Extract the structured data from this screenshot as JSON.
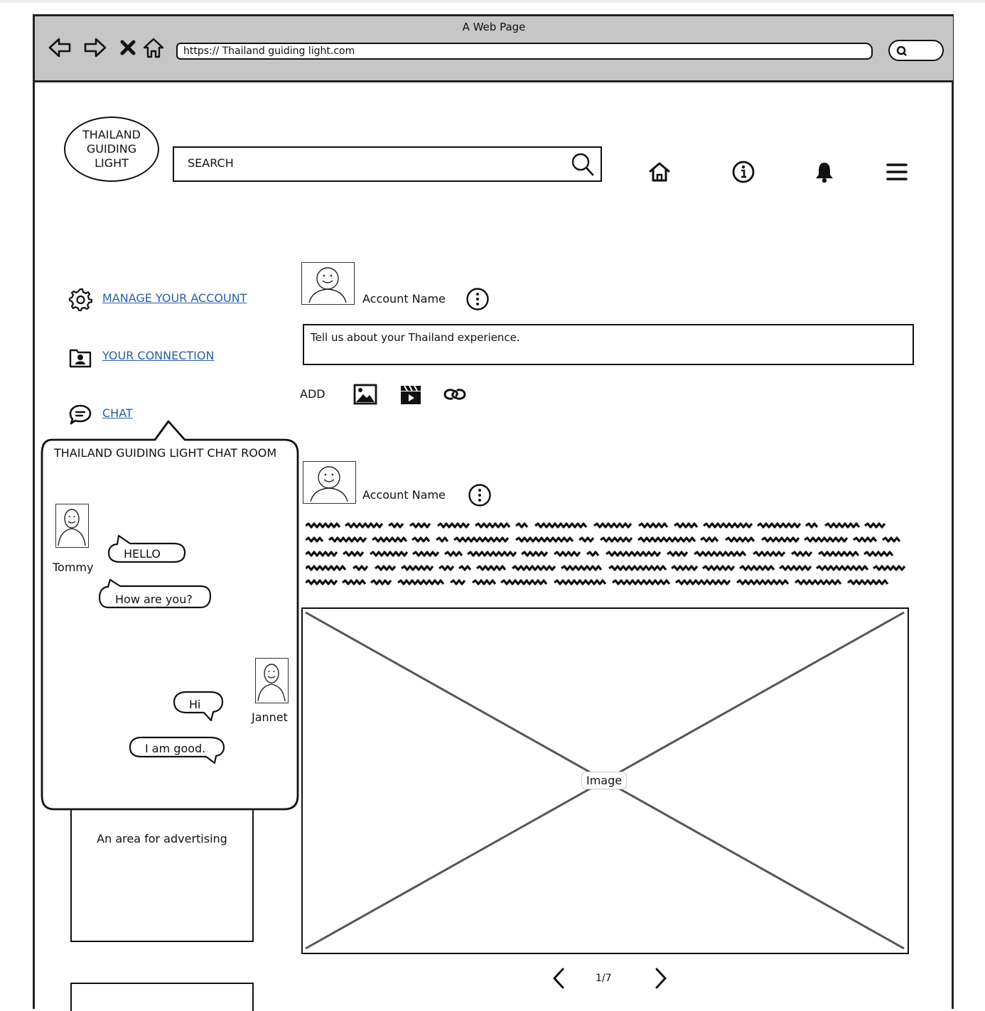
{
  "browser": {
    "window_title": "A Web Page",
    "url": "https:// Thailand guiding light.com",
    "nav_icons": [
      "back-arrow-icon",
      "forward-arrow-icon",
      "close-x-icon",
      "home-outline-icon"
    ]
  },
  "header": {
    "logo_line1": "THAILAND",
    "logo_line2": "GUIDING",
    "logo_line3": "LIGHT",
    "search_placeholder": "SEARCH",
    "icons": [
      "home-icon",
      "info-icon",
      "bell-icon",
      "hamburger-menu-icon"
    ]
  },
  "sidebar": {
    "items": [
      {
        "label": "MANAGE YOUR ACCOUNT",
        "icon": "gear-icon"
      },
      {
        "label": "YOUR CONNECTION",
        "icon": "contact-card-icon"
      },
      {
        "label": "CHAT",
        "icon": "chat-bubble-icon"
      }
    ]
  },
  "chat_room": {
    "title": "THAILAND GUIDING LIGHT CHAT ROOM",
    "users": [
      {
        "name": "Tommy"
      },
      {
        "name": "Jannet"
      }
    ],
    "messages": [
      {
        "from": "Tommy",
        "text": "HELLO"
      },
      {
        "from": "Tommy",
        "text": "How are you?"
      },
      {
        "from": "Jannet",
        "text": "Hi"
      },
      {
        "from": "Jannet",
        "text": "I am good."
      }
    ]
  },
  "advertising": {
    "text": "An area for advertising"
  },
  "composer": {
    "account_name": "Account Name",
    "placeholder": "Tell us about your Thailand experience.",
    "add_label": "ADD",
    "add_icons": [
      "image-icon",
      "video-clapper-icon",
      "link-icon"
    ]
  },
  "post": {
    "account_name": "Account Name",
    "image_label": "Image",
    "pager_text": "1/7"
  }
}
